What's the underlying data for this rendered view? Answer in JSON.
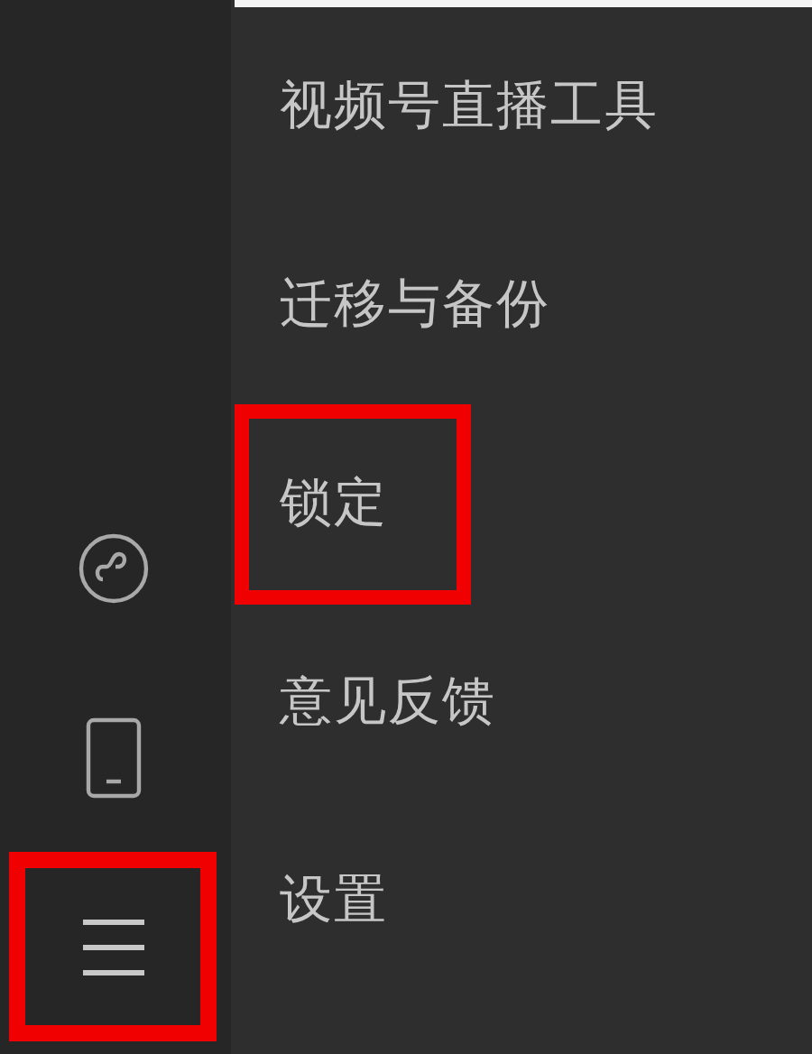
{
  "sidebar": {
    "items": [
      {
        "kind": "mini-program",
        "annotated": false
      },
      {
        "kind": "phone",
        "annotated": false
      },
      {
        "kind": "menu",
        "annotated": true
      }
    ]
  },
  "menu": {
    "items": [
      {
        "label": "视频号直播工具",
        "annotated": false
      },
      {
        "label": "迁移与备份",
        "annotated": false
      },
      {
        "label": "锁定",
        "annotated": true
      },
      {
        "label": "意见反馈",
        "annotated": false
      },
      {
        "label": "设置",
        "annotated": false
      }
    ]
  }
}
